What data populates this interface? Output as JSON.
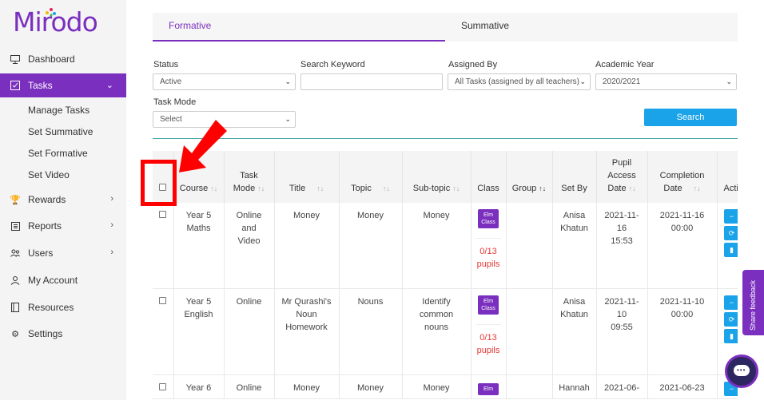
{
  "app": {
    "name": "Mirodo"
  },
  "sidebar": {
    "items": [
      {
        "label": "Dashboard",
        "icon": "monitor-icon"
      },
      {
        "label": "Tasks",
        "icon": "tasks-icon",
        "active": true
      },
      {
        "label": "Rewards",
        "icon": "trophy-icon"
      },
      {
        "label": "Reports",
        "icon": "report-icon"
      },
      {
        "label": "Users",
        "icon": "users-icon"
      },
      {
        "label": "My Account",
        "icon": "account-icon"
      },
      {
        "label": "Resources",
        "icon": "book-icon"
      },
      {
        "label": "Settings",
        "icon": "gear-icon"
      }
    ],
    "sub_items": [
      "Manage Tasks",
      "Set Summative",
      "Set Formative",
      "Set Video"
    ]
  },
  "tabs": [
    "Formative",
    "Summative"
  ],
  "filters": {
    "status_label": "Status",
    "status_value": "Active",
    "keyword_label": "Search Keyword",
    "keyword_value": "",
    "assigned_label": "Assigned By",
    "assigned_value": "All Tasks (assigned by all teachers)",
    "year_label": "Academic Year",
    "year_value": "2020/2021",
    "mode_label": "Task Mode",
    "mode_value": "Select",
    "search_button": "Search"
  },
  "table": {
    "headers": {
      "course": "Course",
      "task_mode": [
        "Task",
        "Mode"
      ],
      "title": "Title",
      "topic": "Topic",
      "subtopic": "Sub-topic",
      "class": "Class",
      "group": "Group",
      "set_by": "Set By",
      "pupil_access": [
        "Pupil",
        "Access",
        "Date"
      ],
      "completion": [
        "Completion",
        "Date"
      ],
      "actions": "Actions"
    },
    "rows": [
      {
        "course": [
          "Year 5",
          "Maths"
        ],
        "task_mode": [
          "Online",
          "and",
          "Video"
        ],
        "title": [
          "Money"
        ],
        "topic": "Money",
        "subtopic": [
          "Money"
        ],
        "class_badge": [
          "Elm",
          "Class"
        ],
        "pupils": [
          "0/13",
          "pupils"
        ],
        "set_by": [
          "Anisa",
          "Khatun"
        ],
        "pupil_access": [
          "2021-11-",
          "16",
          "15:53"
        ],
        "completion": [
          "2021-11-16",
          "00:00"
        ]
      },
      {
        "course": [
          "Year 5",
          "English"
        ],
        "task_mode": [
          "Online"
        ],
        "title": [
          "Mr Qurashi's",
          "Noun",
          "Homework"
        ],
        "topic": "Nouns",
        "subtopic": [
          "Identify",
          "common",
          "nouns"
        ],
        "class_badge": [
          "Elm",
          "Class"
        ],
        "pupils": [
          "0/13",
          "pupils"
        ],
        "set_by": [
          "Anisa",
          "Khatun"
        ],
        "pupil_access": [
          "2021-11-",
          "10",
          "09:55"
        ],
        "completion": [
          "2021-11-10",
          "00:00"
        ]
      },
      {
        "course": [
          "Year 6"
        ],
        "task_mode": [
          "Online"
        ],
        "title": [
          "Money"
        ],
        "topic": "Money",
        "subtopic": [
          "Money"
        ],
        "class_badge": [
          "Elm"
        ],
        "pupils": [],
        "set_by": [
          "Hannah"
        ],
        "pupil_access": [
          "2021-06-"
        ],
        "completion": [
          "2021-06-23"
        ]
      }
    ]
  },
  "feedback": "Share feedback"
}
